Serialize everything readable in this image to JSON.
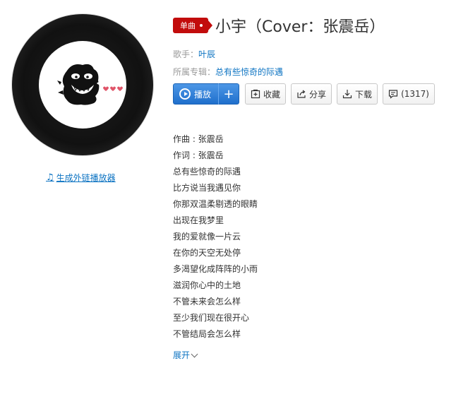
{
  "cover": {
    "icon": "vinyl-record-cover"
  },
  "ext_player": {
    "label": "生成外链播放器",
    "icon": "music-note-icon"
  },
  "song": {
    "tag": "单曲",
    "title": "小宇（Cover：张震岳）",
    "singer_label": "歌手：",
    "singer": "叶辰",
    "album_label": "所属专辑：",
    "album": "总有些惊奇的际遇"
  },
  "actions": {
    "play": "播放",
    "add": "+",
    "collect": "收藏",
    "share": "分享",
    "download": "下载",
    "comment": "(1317)"
  },
  "lyrics": [
    "作曲 : 张震岳",
    "作词 : 张震岳",
    "总有些惊奇的际遇",
    "比方说当我遇见你",
    "你那双温柔剔透的眼睛",
    "出现在我梦里",
    "我的爱就像一片云",
    "在你的天空无处停",
    "多渴望化成阵阵的小雨",
    "滋润你心中的土地",
    "不管未来会怎么样",
    "至少我们现在很开心",
    "不管结局会怎么样"
  ],
  "expand_label": "展开",
  "colors": {
    "accent": "#c20c0c",
    "link": "#0c73c2",
    "play_blue": "#2b7fd8"
  }
}
